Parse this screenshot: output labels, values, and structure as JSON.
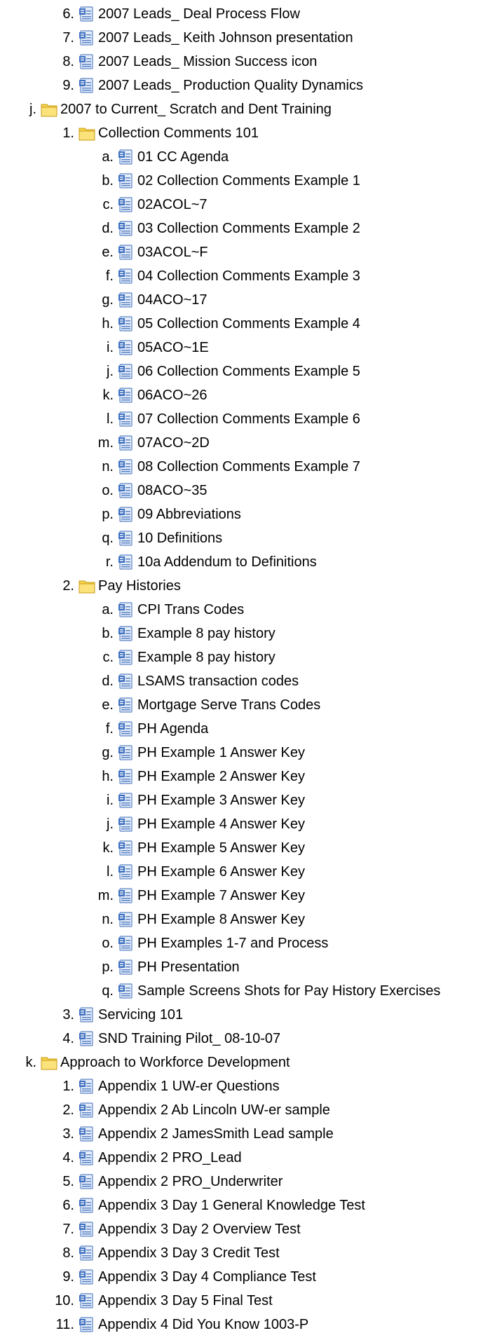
{
  "items": [
    {
      "level": 2,
      "marker": "6.",
      "type": "doc",
      "label": "2007 Leads_ Deal Process Flow"
    },
    {
      "level": 2,
      "marker": "7.",
      "type": "doc",
      "label": "2007 Leads_ Keith Johnson presentation"
    },
    {
      "level": 2,
      "marker": "8.",
      "type": "doc",
      "label": "2007 Leads_ Mission Success icon"
    },
    {
      "level": 2,
      "marker": "9.",
      "type": "doc",
      "label": "2007 Leads_ Production Quality Dynamics"
    },
    {
      "level": 1,
      "marker": "j.",
      "type": "folder",
      "label": "2007 to Current_ Scratch and Dent Training"
    },
    {
      "level": 2,
      "marker": "1.",
      "type": "folder",
      "label": "Collection Comments 101"
    },
    {
      "level": 3,
      "marker": "a.",
      "type": "doc",
      "label": "01 CC Agenda"
    },
    {
      "level": 3,
      "marker": "b.",
      "type": "doc",
      "label": "02 Collection Comments Example 1"
    },
    {
      "level": 3,
      "marker": "c.",
      "type": "doc",
      "label": "02ACOL~7"
    },
    {
      "level": 3,
      "marker": "d.",
      "type": "doc",
      "label": "03 Collection Comments Example 2"
    },
    {
      "level": 3,
      "marker": "e.",
      "type": "doc",
      "label": "03ACOL~F"
    },
    {
      "level": 3,
      "marker": "f.",
      "type": "doc",
      "label": "04 Collection Comments Example 3"
    },
    {
      "level": 3,
      "marker": "g.",
      "type": "doc",
      "label": "04ACO~17"
    },
    {
      "level": 3,
      "marker": "h.",
      "type": "doc",
      "label": "05 Collection Comments Example 4"
    },
    {
      "level": 3,
      "marker": "i.",
      "type": "doc",
      "label": "05ACO~1E"
    },
    {
      "level": 3,
      "marker": "j.",
      "type": "doc",
      "label": "06 Collection Comments Example 5"
    },
    {
      "level": 3,
      "marker": "k.",
      "type": "doc",
      "label": "06ACO~26"
    },
    {
      "level": 3,
      "marker": "l.",
      "type": "doc",
      "label": "07 Collection Comments Example 6"
    },
    {
      "level": 3,
      "marker": "m.",
      "type": "doc",
      "label": "07ACO~2D"
    },
    {
      "level": 3,
      "marker": "n.",
      "type": "doc",
      "label": "08 Collection Comments Example 7"
    },
    {
      "level": 3,
      "marker": "o.",
      "type": "doc",
      "label": "08ACO~35"
    },
    {
      "level": 3,
      "marker": "p.",
      "type": "doc",
      "label": "09 Abbreviations"
    },
    {
      "level": 3,
      "marker": "q.",
      "type": "doc",
      "label": "10 Definitions"
    },
    {
      "level": 3,
      "marker": "r.",
      "type": "doc",
      "label": "10a Addendum to Definitions"
    },
    {
      "level": 2,
      "marker": "2.",
      "type": "folder",
      "label": "Pay Histories"
    },
    {
      "level": 3,
      "marker": "a.",
      "type": "doc",
      "label": "CPI Trans Codes"
    },
    {
      "level": 3,
      "marker": "b.",
      "type": "doc",
      "label": "Example 8 pay history"
    },
    {
      "level": 3,
      "marker": "c.",
      "type": "doc",
      "label": "Example 8 pay history"
    },
    {
      "level": 3,
      "marker": "d.",
      "type": "doc",
      "label": "LSAMS transaction codes"
    },
    {
      "level": 3,
      "marker": "e.",
      "type": "doc",
      "label": "Mortgage Serve Trans Codes"
    },
    {
      "level": 3,
      "marker": "f.",
      "type": "doc",
      "label": "PH Agenda"
    },
    {
      "level": 3,
      "marker": "g.",
      "type": "doc",
      "label": "PH Example 1 Answer Key"
    },
    {
      "level": 3,
      "marker": "h.",
      "type": "doc",
      "label": "PH Example 2 Answer Key"
    },
    {
      "level": 3,
      "marker": "i.",
      "type": "doc",
      "label": "PH Example 3 Answer Key"
    },
    {
      "level": 3,
      "marker": "j.",
      "type": "doc",
      "label": "PH Example 4 Answer Key"
    },
    {
      "level": 3,
      "marker": "k.",
      "type": "doc",
      "label": "PH Example 5 Answer Key"
    },
    {
      "level": 3,
      "marker": "l.",
      "type": "doc",
      "label": "PH Example 6 Answer Key"
    },
    {
      "level": 3,
      "marker": "m.",
      "type": "doc",
      "label": "PH Example 7 Answer Key"
    },
    {
      "level": 3,
      "marker": "n.",
      "type": "doc",
      "label": "PH Example 8 Answer Key"
    },
    {
      "level": 3,
      "marker": "o.",
      "type": "doc",
      "label": "PH Examples 1-7 and Process"
    },
    {
      "level": 3,
      "marker": "p.",
      "type": "doc",
      "label": "PH Presentation"
    },
    {
      "level": 3,
      "marker": "q.",
      "type": "doc",
      "label": "Sample Screens Shots for Pay History Exercises"
    },
    {
      "level": 2,
      "marker": "3.",
      "type": "doc",
      "label": "Servicing 101"
    },
    {
      "level": 2,
      "marker": "4.",
      "type": "doc",
      "label": "SND Training Pilot_ 08-10-07"
    },
    {
      "level": 1,
      "marker": "k.",
      "type": "folder",
      "label": "Approach to Workforce Development"
    },
    {
      "level": 2,
      "marker": "1.",
      "type": "doc",
      "label": "Appendix 1 UW-er Questions"
    },
    {
      "level": 2,
      "marker": "2.",
      "type": "doc",
      "label": "Appendix 2 Ab Lincoln UW-er sample"
    },
    {
      "level": 2,
      "marker": "3.",
      "type": "doc",
      "label": "Appendix 2 JamesSmith Lead sample"
    },
    {
      "level": 2,
      "marker": "4.",
      "type": "doc",
      "label": "Appendix 2 PRO_Lead"
    },
    {
      "level": 2,
      "marker": "5.",
      "type": "doc",
      "label": "Appendix 2 PRO_Underwriter"
    },
    {
      "level": 2,
      "marker": "6.",
      "type": "doc",
      "label": "Appendix 3 Day 1 General Knowledge Test"
    },
    {
      "level": 2,
      "marker": "7.",
      "type": "doc",
      "label": "Appendix 3 Day 2 Overview Test"
    },
    {
      "level": 2,
      "marker": "8.",
      "type": "doc",
      "label": "Appendix 3 Day 3 Credit Test"
    },
    {
      "level": 2,
      "marker": "9.",
      "type": "doc",
      "label": "Appendix 3 Day 4 Compliance Test"
    },
    {
      "level": 2,
      "marker": "10.",
      "type": "doc",
      "label": "Appendix 3 Day 5 Final Test"
    },
    {
      "level": 2,
      "marker": "11.",
      "type": "doc",
      "label": "Appendix 4 Did You Know 1003-P"
    }
  ]
}
